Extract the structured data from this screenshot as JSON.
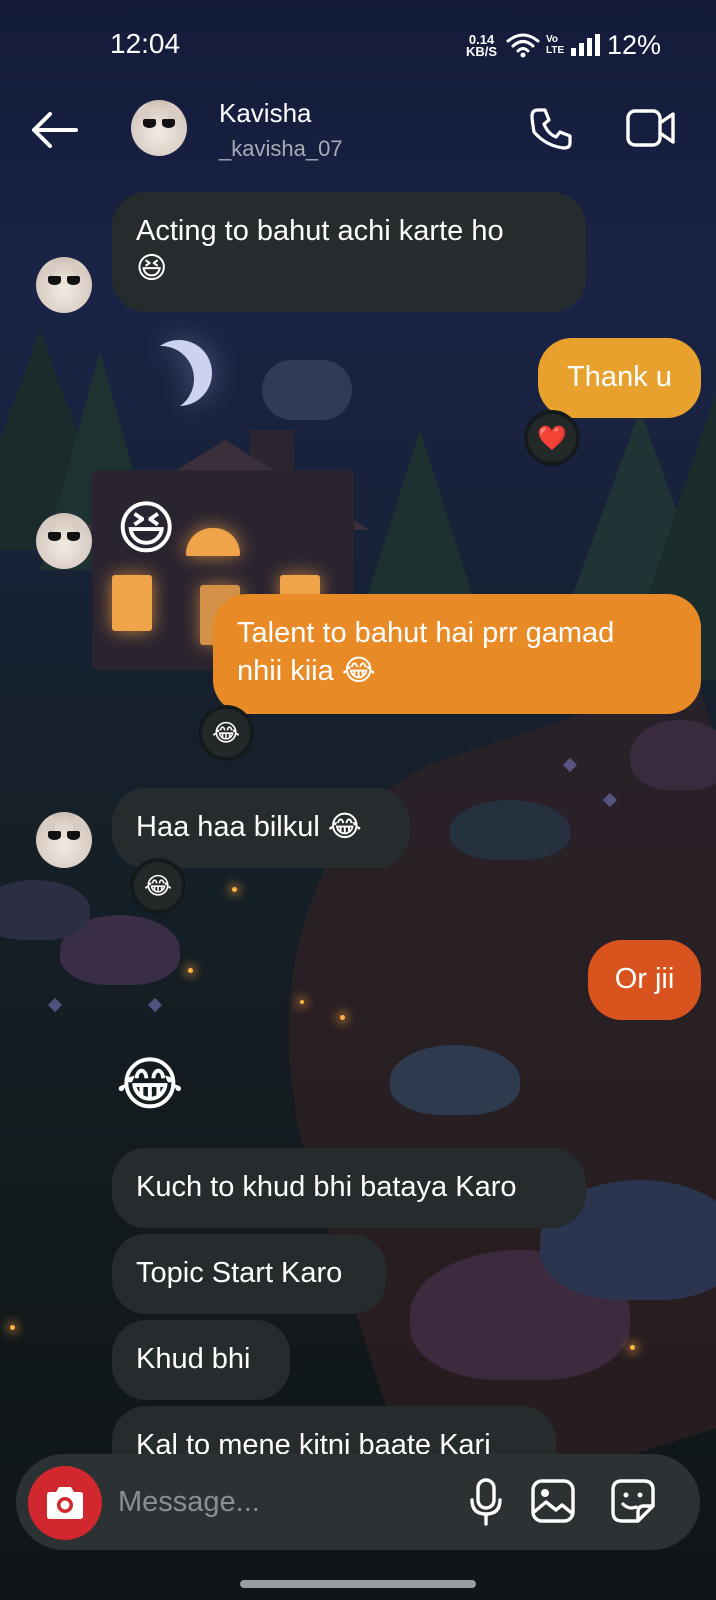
{
  "status_bar": {
    "time": "12:04",
    "net_speed_value": "0.14",
    "net_speed_unit": "KB/S",
    "volte_top": "Vo",
    "volte_bottom": "LTE",
    "battery": "12%"
  },
  "header": {
    "name": "Kavisha",
    "username": "_kavisha_07"
  },
  "messages": {
    "m1": "Acting to bahut achi karte ho",
    "m1_emoji": "😆",
    "m2": "Thank u",
    "m2_reaction": "❤️",
    "m3_emoji": "😆",
    "m4_line1": "Talent to bahut hai prr gamad",
    "m4_line2": "nhii kiia 😂",
    "m4_reaction": "😂",
    "m5": "Haa haa bilkul 😂",
    "m5_reaction": "😂",
    "m6": "Or jii",
    "m7_emoji": "😂",
    "m8": "Kuch to khud bhi bataya Karo",
    "m9": "Topic Start Karo",
    "m10": "Khud bhi",
    "m11": "Kal to mene kitni baate Kari"
  },
  "composer": {
    "placeholder": "Message..."
  },
  "colors": {
    "incoming_bubble": "#262b2d",
    "outgoing_yellow": "#e8a12c",
    "outgoing_orange": "#e88a25",
    "outgoing_red_orange": "#d9531e",
    "camera_button": "#d1272e"
  },
  "icons": [
    "back-arrow-icon",
    "phone-icon",
    "video-camera-icon",
    "camera-icon",
    "microphone-icon",
    "gallery-icon",
    "sticker-icon",
    "wifi-icon",
    "signal-icon"
  ]
}
